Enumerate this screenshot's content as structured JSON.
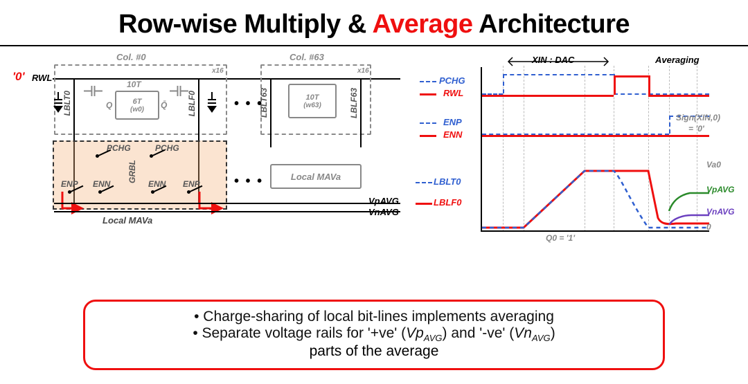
{
  "title": {
    "pre": "Row-wise Multiply & ",
    "highlight": "Average",
    "post": " Architecture"
  },
  "circuit": {
    "input_value": "'0'",
    "rwl": "RWL",
    "col0": "Col. #0",
    "col63": "Col. #63",
    "x16a": "x16",
    "x16b": "x16",
    "ten_t_a": "10T",
    "six_t": "6T",
    "w0": "(w0)",
    "q": "Q",
    "qbar": "Q̄",
    "ten_t_b": "10T",
    "w63": "(w63)",
    "lblt0": "LBLT0",
    "lblf0": "LBLF0",
    "lblt63": "LBLT63",
    "lblf63": "LBLF63",
    "pchg1": "PCHG",
    "pchg2": "PCHG",
    "grbl": "GRBL",
    "enp1": "ENP",
    "enn1": "ENN",
    "enn2": "ENN",
    "enp2": "ENP",
    "local_mava_box": "Local MAVa",
    "local_mava_caption": "Local MAVa",
    "vp_avg": "VpAVG",
    "vn_avg": "VnAVG",
    "dots1": "• • •",
    "dots2": "• • •"
  },
  "timing": {
    "phase_dac": "XIN : DAC",
    "phase_avg": "Averaging",
    "pchg": "PCHG",
    "rwl": "RWL",
    "enp": "ENP",
    "enn": "ENN",
    "sign": "Sign(XIN,0)",
    "sign_val": "= '0'",
    "lblt0": "LBLT0",
    "lblf0": "LBLF0",
    "va0": "Va0",
    "vp_avg": "VpAVG",
    "vn_avg": "VnAVG",
    "zero": "0",
    "q0": "Q0 = '1'"
  },
  "callout": {
    "b1": "Charge-sharing of local bit-lines implements averaging",
    "b2_pre": "Separate voltage rails for '+ve' (",
    "b2_vp": "Vp",
    "b2_vp_sub": "AVG",
    "b2_mid": ") and '-ve' (",
    "b2_vn": "Vn",
    "b2_vn_sub": "AVG",
    "b2_post": ")",
    "b3": "parts of the average"
  }
}
